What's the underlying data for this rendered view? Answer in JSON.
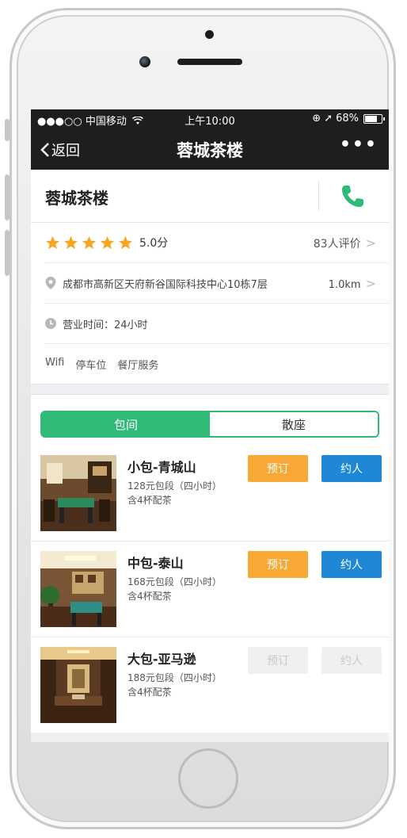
{
  "statusbar": {
    "carrier": "●●●○○ 中国移动",
    "time": "上午10:00",
    "battery_percent": "68%",
    "battery_level": 0.68
  },
  "navbar": {
    "back_label": "返回",
    "title": "蓉城茶楼",
    "more_label": "•••"
  },
  "shop": {
    "name": "蓉城茶楼",
    "rating_stars": 5,
    "score": "5.0分",
    "reviews": "83人评价",
    "address": "成都市高新区天府新谷国际科技中心10栋7层",
    "distance": "1.0km",
    "hours": "营业时间：24小时",
    "amenities": [
      "Wifi",
      "停车位",
      "餐厅服务"
    ]
  },
  "tabs": {
    "private_room": "包间",
    "hall_seat": "散座",
    "active": "包间"
  },
  "rooms": [
    {
      "name": "小包-青城山",
      "price": "128元包段（四小时）",
      "tea": "含4杯配茶",
      "book_label": "预订",
      "invite_label": "约人",
      "available": true
    },
    {
      "name": "中包-泰山",
      "price": "168元包段（四小时）",
      "tea": "含4杯配茶",
      "book_label": "预订",
      "invite_label": "约人",
      "available": true
    },
    {
      "name": "大包-亚马逊",
      "price": "188元包段（四小时）",
      "tea": "含4杯配茶",
      "book_label": "预订",
      "invite_label": "约人",
      "available": false
    }
  ],
  "colors": {
    "accent_green": "#2fba78",
    "book_orange": "#f7a835",
    "invite_blue": "#1e88d6",
    "star_orange": "#f5a623",
    "phone_green": "#2fba78"
  },
  "icons": {
    "call": "phone-icon",
    "star": "star-icon",
    "location": "location-pin-icon",
    "clock": "clock-icon",
    "back": "chevron-left-icon",
    "more": "more-dots-icon"
  }
}
